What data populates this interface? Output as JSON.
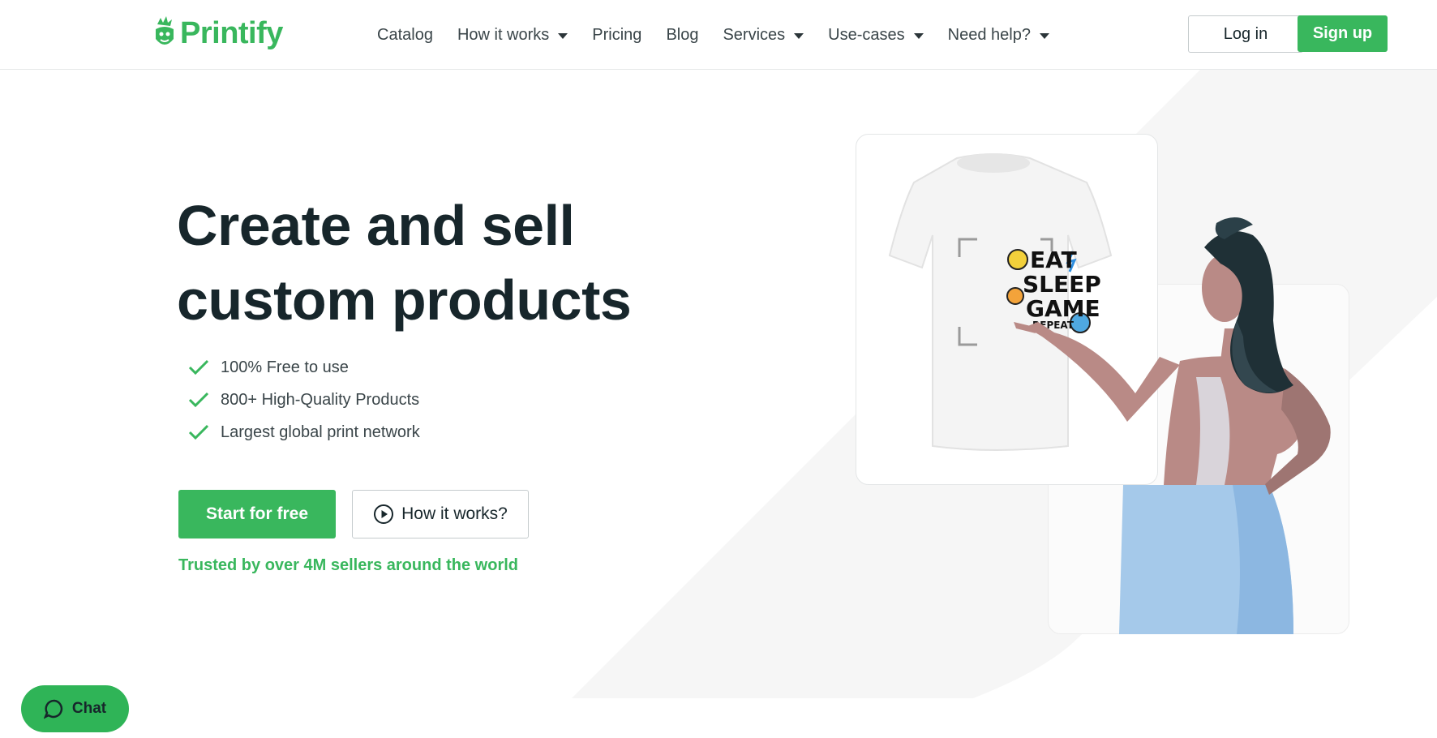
{
  "header": {
    "logo_text": "Printify",
    "nav": [
      {
        "label": "Catalog",
        "dropdown": false
      },
      {
        "label": "How it works",
        "dropdown": true
      },
      {
        "label": "Pricing",
        "dropdown": false
      },
      {
        "label": "Blog",
        "dropdown": false
      },
      {
        "label": "Services",
        "dropdown": true
      },
      {
        "label": "Use-cases",
        "dropdown": true
      },
      {
        "label": "Need help?",
        "dropdown": true
      }
    ],
    "login_label": "Log in",
    "signup_label": "Sign up"
  },
  "hero": {
    "title_line1": "Create and sell",
    "title_line2": "custom products",
    "features": [
      "100% Free to use",
      "800+ High-Quality Products",
      "Largest global print network"
    ],
    "start_label": "Start for free",
    "how_label": "How it works?",
    "trusted_text": "Trusted by over 4M sellers around the world"
  },
  "illustration": {
    "tshirt_print_lines": [
      "EAT",
      "SLEEP",
      "GAME",
      "REPEAT"
    ]
  },
  "chat": {
    "label": "Chat"
  },
  "colors": {
    "brand_green": "#39b75d",
    "text_dark": "#17262b",
    "text_body": "#3a4549",
    "skin": "#b98a86",
    "hair": "#1f3036",
    "skirt": "#a5c9ea"
  },
  "icons": [
    "printify-logo-icon",
    "chevron-down-icon",
    "check-icon",
    "play-circle-icon",
    "chat-bubble-icon"
  ]
}
